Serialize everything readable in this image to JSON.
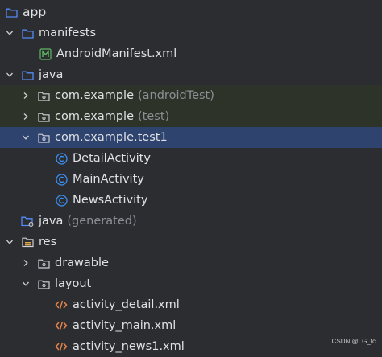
{
  "colors": {
    "background": "#2b2d30",
    "selection": "#2e436e",
    "test_highlight": "#2d3329",
    "folder_blue": "#548af7",
    "class_blue": "#3d8ef0",
    "manifest_green": "#5fb865",
    "xml_orange": "#e8844a"
  },
  "tree": {
    "app": {
      "label": "app",
      "icon": "folder-icon",
      "expanded": true
    },
    "manifests": {
      "label": "manifests",
      "icon": "folder-icon",
      "expanded": true
    },
    "android_manifest": {
      "label": "AndroidManifest.xml",
      "icon": "manifest-file-icon"
    },
    "java": {
      "label": "java",
      "icon": "source-folder-icon",
      "expanded": true
    },
    "pkg_android_test": {
      "label": "com.example",
      "suffix": "(androidTest)",
      "icon": "package-icon",
      "expanded": false
    },
    "pkg_test": {
      "label": "com.example",
      "suffix": "(test)",
      "icon": "package-icon",
      "expanded": false
    },
    "pkg_test1": {
      "label": "com.example.test1",
      "icon": "package-icon",
      "expanded": true,
      "selected": true
    },
    "detail_activity": {
      "label": "DetailActivity",
      "icon": "class-icon"
    },
    "main_activity": {
      "label": "MainActivity",
      "icon": "class-icon"
    },
    "news_activity": {
      "label": "NewsActivity",
      "icon": "class-icon"
    },
    "java_generated": {
      "label": "java",
      "suffix": "(generated)",
      "icon": "generated-folder-icon"
    },
    "res": {
      "label": "res",
      "icon": "resources-folder-icon",
      "expanded": true
    },
    "drawable": {
      "label": "drawable",
      "icon": "package-icon",
      "expanded": false
    },
    "layout": {
      "label": "layout",
      "icon": "package-icon",
      "expanded": true
    },
    "activity_detail": {
      "label": "activity_detail.xml",
      "icon": "xml-file-icon"
    },
    "activity_main": {
      "label": "activity_main.xml",
      "icon": "xml-file-icon"
    },
    "activity_news1": {
      "label": "activity_news1.xml",
      "icon": "xml-file-icon"
    }
  },
  "watermark": "CSDN @LG_tc"
}
